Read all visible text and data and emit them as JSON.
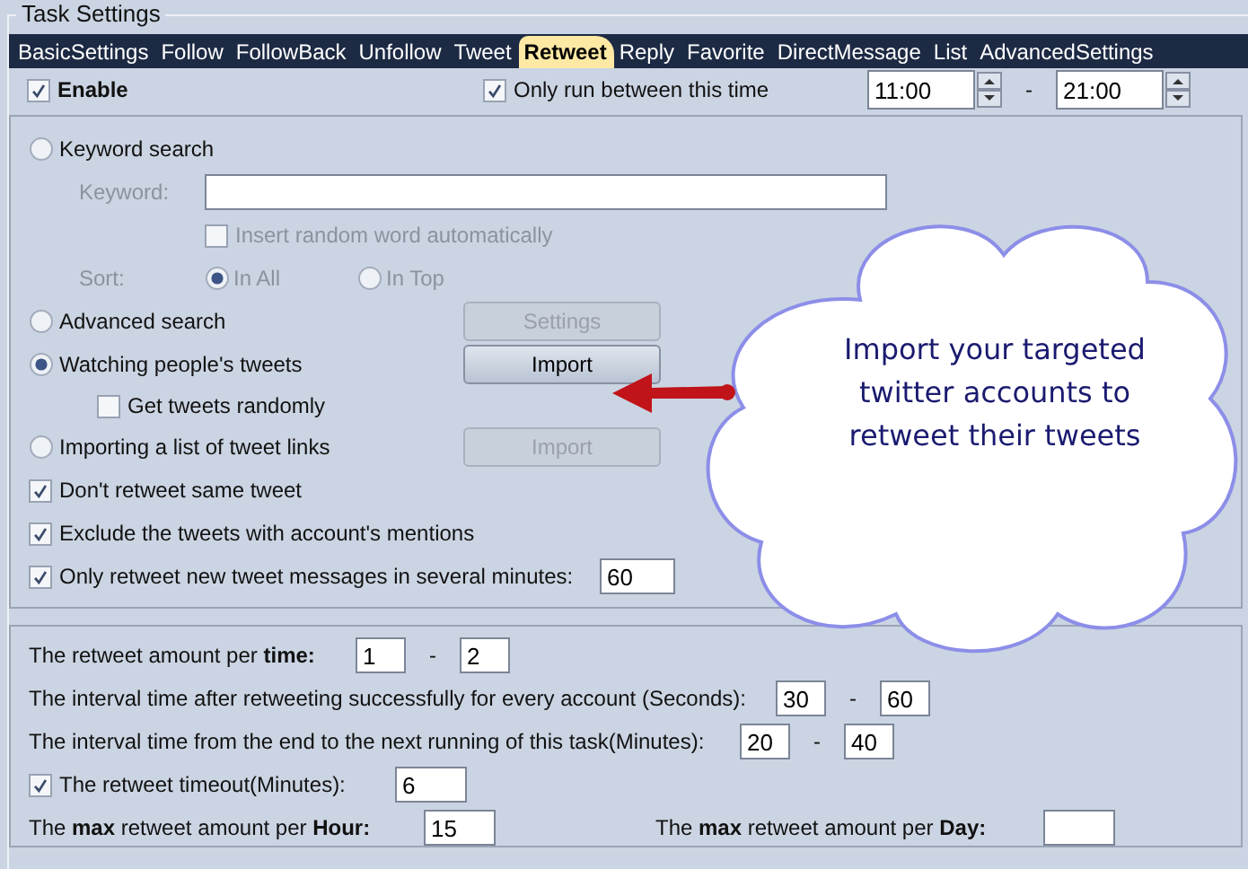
{
  "group_title": "Task Settings",
  "tabs": [
    {
      "label": "BasicSettings",
      "selected": false
    },
    {
      "label": "Follow",
      "selected": false
    },
    {
      "label": "FollowBack",
      "selected": false
    },
    {
      "label": "Unfollow",
      "selected": false
    },
    {
      "label": "Tweet",
      "selected": false
    },
    {
      "label": "Retweet",
      "selected": true
    },
    {
      "label": "Reply",
      "selected": false
    },
    {
      "label": "Favorite",
      "selected": false
    },
    {
      "label": "DirectMessage",
      "selected": false
    },
    {
      "label": "List",
      "selected": false
    },
    {
      "label": "AdvancedSettings",
      "selected": false
    }
  ],
  "enable": {
    "label": "Enable",
    "checked": true
  },
  "schedule": {
    "label": "Only run between this time",
    "checked": true,
    "from": "11:00",
    "separator": "-",
    "to": "21:00"
  },
  "keyword_search": {
    "label": "Keyword search",
    "selected": false,
    "field_label": "Keyword:",
    "random_word": {
      "label": "Insert random word automatically",
      "checked": false
    },
    "sort_label": "Sort:",
    "sort_options": [
      {
        "label": "In All",
        "selected": true
      },
      {
        "label": "In Top",
        "selected": false
      }
    ],
    "disabled": true
  },
  "modes": [
    {
      "label": "Advanced search",
      "selected": false,
      "button": {
        "label": "Settings",
        "disabled": true
      }
    },
    {
      "label": "Watching people's tweets",
      "selected": true,
      "button": {
        "label": "Import",
        "disabled": false
      },
      "sub_option": {
        "label": "Get tweets randomly",
        "checked": false
      }
    },
    {
      "label": "Importing a list of tweet links",
      "selected": false,
      "button": {
        "label": "Import",
        "disabled": true
      }
    }
  ],
  "options": [
    {
      "label": "Don't retweet same tweet",
      "checked": true
    },
    {
      "label": "Exclude the tweets with account's mentions",
      "checked": true
    },
    {
      "label": "Only retweet new tweet messages in several minutes:",
      "checked": true,
      "value": "60"
    }
  ],
  "callout": {
    "text": "Import your targeted twitter accounts to retweet their tweets"
  },
  "limits": [
    {
      "kind": "range",
      "label": "The retweet amount per **time:**",
      "from": "1",
      "separator": "-",
      "to": "2"
    },
    {
      "kind": "range",
      "label": "The interval time after retweeting successfully for every account (Seconds):",
      "from": "30",
      "separator": "-",
      "to": "60"
    },
    {
      "kind": "range",
      "label": "The interval time from the end to the next running of this task(Minutes):",
      "from": "20",
      "separator": "-",
      "to": "40"
    },
    {
      "kind": "check",
      "label": "The retweet timeout(Minutes):",
      "checked": true,
      "value": "6"
    }
  ],
  "max_limits": [
    {
      "label": "The **max** retweet amount per **Hour:**",
      "value": "15"
    },
    {
      "label": "The **max** retweet amount per **Day:**"
    }
  ]
}
